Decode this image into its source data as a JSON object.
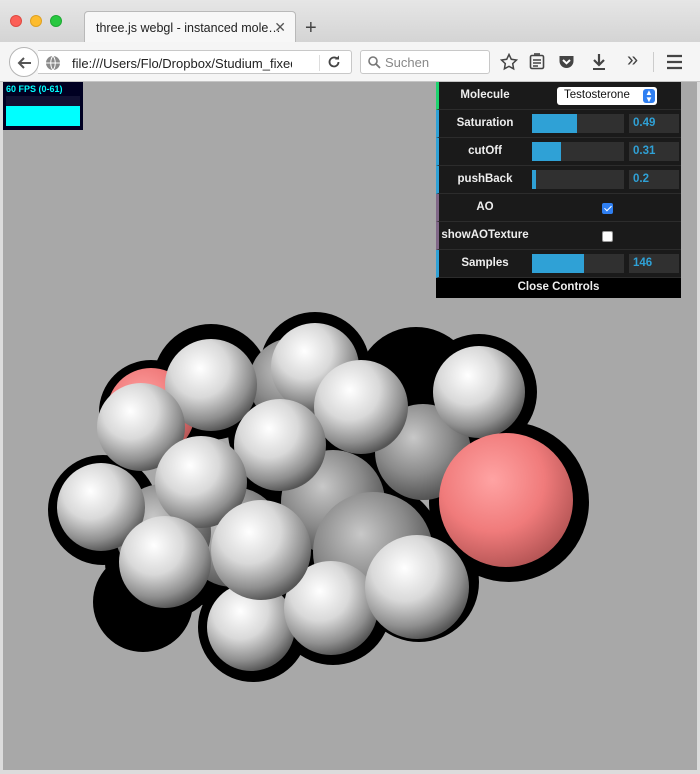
{
  "tab": {
    "title": "three.js webgl - instanced mole…",
    "close_glyph": "✕",
    "new_tab_glyph": "+"
  },
  "navbar": {
    "url": "file:///Users/Flo/Dropbox/Studium_fixed",
    "search_placeholder": "Suchen",
    "overflow_glyph": "»"
  },
  "stats": {
    "fps_text": "60 FPS (0-61)",
    "fps_level": 1.0
  },
  "gui": {
    "molecule": {
      "label": "Molecule",
      "value": "Testosterone"
    },
    "sliders": [
      {
        "label": "Saturation",
        "value": "0.49",
        "fraction": 0.49
      },
      {
        "label": "cutOff",
        "value": "0.31",
        "fraction": 0.31
      },
      {
        "label": "pushBack",
        "value": "0.2",
        "fraction": 0.04
      }
    ],
    "ao": {
      "label": "AO",
      "checked": true
    },
    "showAOTexture": {
      "label": "showAOTexture",
      "checked": false
    },
    "samples": {
      "label": "Samples",
      "value": "146",
      "fraction": 0.56
    },
    "close_label": "Close Controls"
  },
  "colors": {
    "viewport_bg": "#a8a8a8",
    "gui_accent": "#2fa1d6",
    "oxygen": "#f07b7b",
    "carbon": "#ffffff"
  }
}
